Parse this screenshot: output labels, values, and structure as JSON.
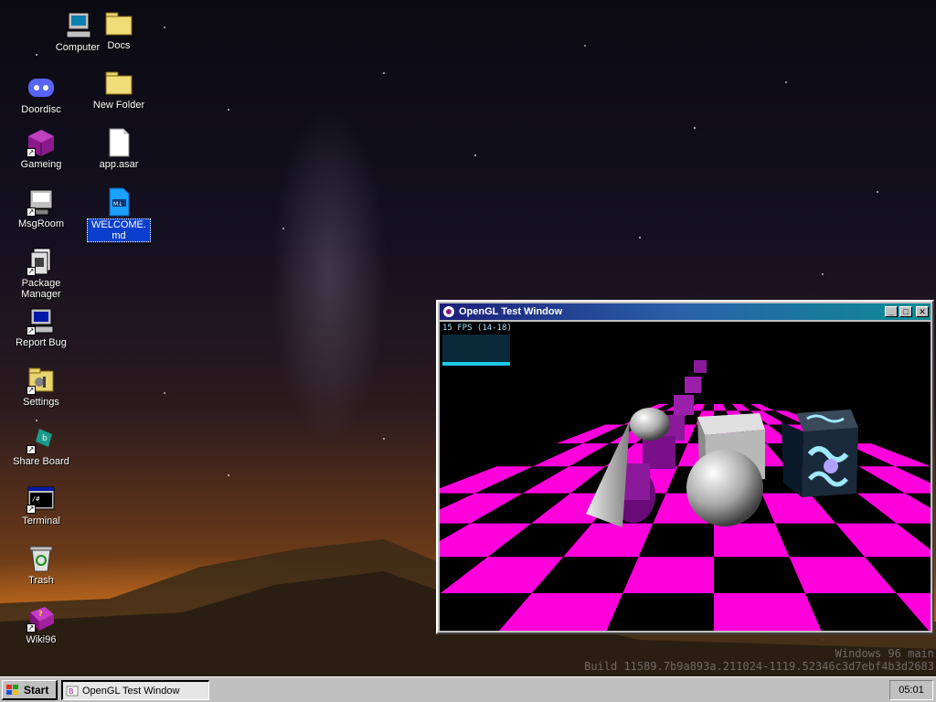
{
  "desktop": {
    "icons": [
      {
        "label": "Computer",
        "icon": "computer-icon"
      },
      {
        "label": "Docs",
        "icon": "folder-icon"
      },
      {
        "label": "Doordisc",
        "icon": "chat-app-icon"
      },
      {
        "label": "New Folder",
        "icon": "folder-icon"
      },
      {
        "label": "Gameing",
        "icon": "game-cube-icon"
      },
      {
        "label": "app.asar",
        "icon": "file-icon"
      },
      {
        "label": "MsgRoom",
        "icon": "chat-room-icon"
      },
      {
        "label": "WELCOME.md",
        "icon": "markdown-file-icon",
        "selected": true
      },
      {
        "label": "Package Manager",
        "icon": "package-icon"
      },
      {
        "label": "Report Bug",
        "icon": "bug-report-icon"
      },
      {
        "label": "Settings",
        "icon": "settings-icon"
      },
      {
        "label": "Share Board",
        "icon": "share-board-icon"
      },
      {
        "label": "Terminal",
        "icon": "terminal-icon"
      },
      {
        "label": "Trash",
        "icon": "recycle-bin-icon"
      },
      {
        "label": "Wiki96",
        "icon": "wiki-book-icon"
      }
    ],
    "watermark": {
      "line1": "Windows 96 main",
      "line2": "Build 11589.7b9a893a.211024-1119.52346c3d7ebf4b3d2683"
    }
  },
  "window": {
    "title": "OpenGL Test Window",
    "fps_text": "15 FPS (14-18)",
    "buttons": {
      "minimize": "_",
      "maximize": "□",
      "close": "✕"
    },
    "colors": {
      "checker_a": "#ff00dc",
      "checker_b": "#000000",
      "title_start": "#1b1f7a",
      "title_end": "#0c8b94"
    }
  },
  "taskbar": {
    "start_label": "Start",
    "tasks": [
      {
        "label": "OpenGL Test Window"
      }
    ],
    "clock": "05:01"
  }
}
